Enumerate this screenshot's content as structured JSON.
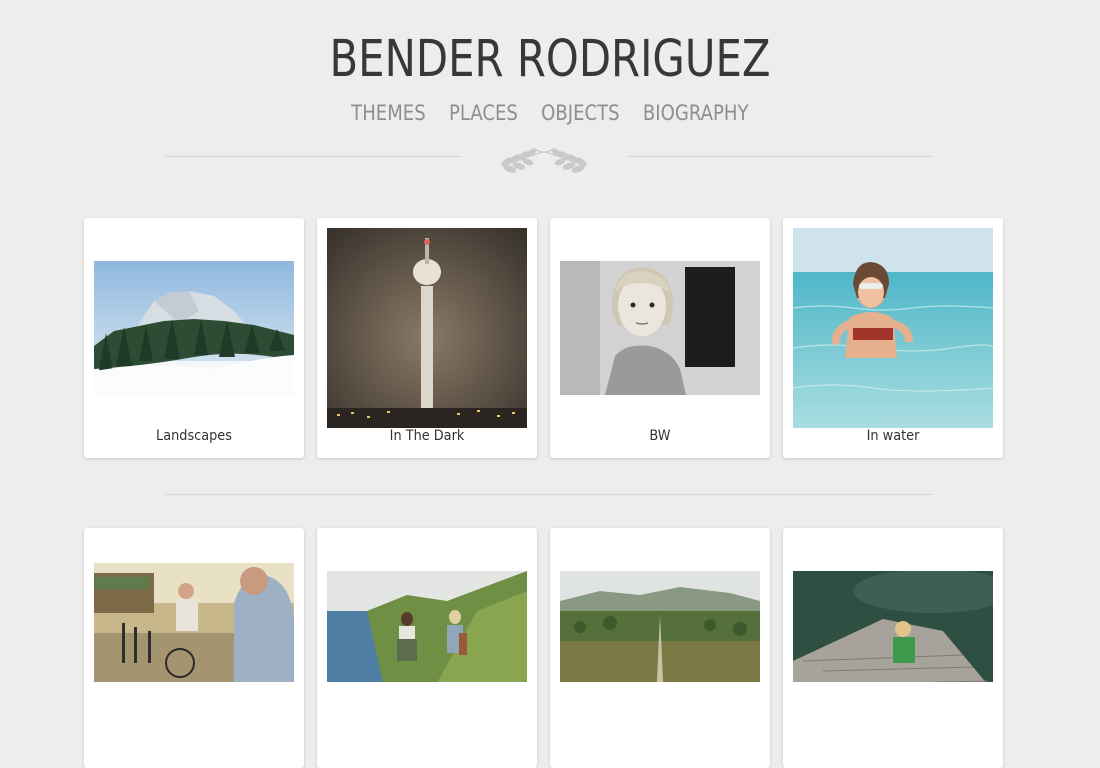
{
  "site": {
    "title": "BENDER RODRIGUEZ"
  },
  "nav": {
    "items": [
      "THEMES",
      "PLACES",
      "OBJECTS",
      "BIOGRAPHY"
    ]
  },
  "gallery": {
    "row1": [
      {
        "caption": "Landscapes",
        "icon": "snowy-mountain-photo"
      },
      {
        "caption": "In The Dark",
        "icon": "tv-tower-night-photo"
      },
      {
        "caption": "BW",
        "icon": "girl-portrait-bw-photo"
      },
      {
        "caption": "In water",
        "icon": "child-in-water-photo"
      }
    ],
    "row2": [
      {
        "caption": "",
        "icon": "street-cyclist-photo"
      },
      {
        "caption": "",
        "icon": "coast-hikers-photo"
      },
      {
        "caption": "",
        "icon": "highland-road-photo"
      },
      {
        "caption": "",
        "icon": "child-on-pier-photo"
      }
    ]
  },
  "colors": {
    "background": "#ededed",
    "title": "#383838",
    "nav": "#8e8e8e",
    "card": "#ffffff"
  }
}
